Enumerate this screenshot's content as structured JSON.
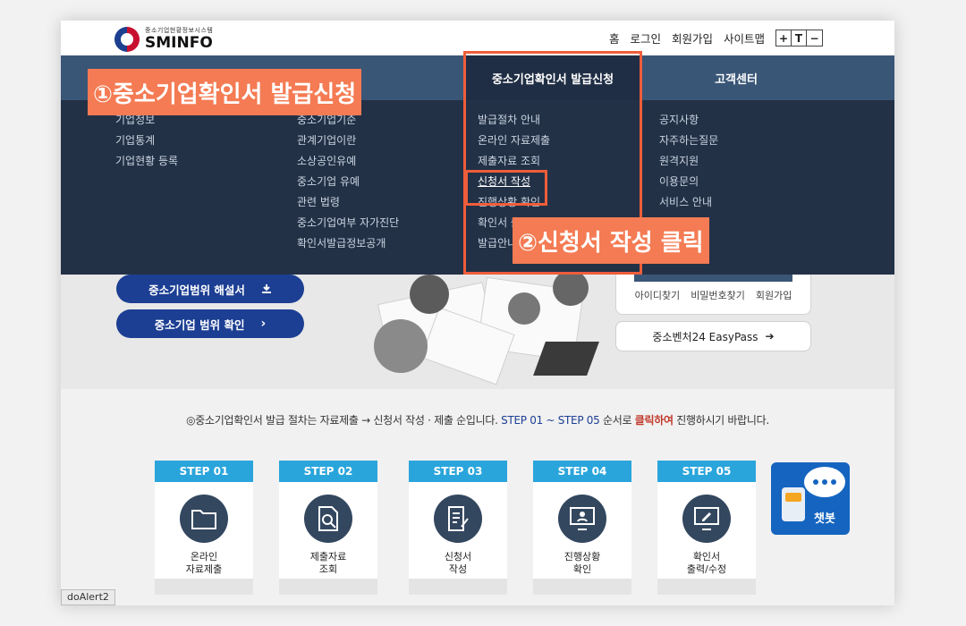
{
  "header": {
    "logo_sub": "중소기업현황정보시스템",
    "logo_main": "SMINFO",
    "util": [
      "홈",
      "로그인",
      "회원가입",
      "사이트맵"
    ],
    "font_controls": [
      "+",
      "T",
      "−"
    ]
  },
  "gnb": {
    "active": "중소기업확인서 발급신청",
    "customer": "고객센터"
  },
  "mega": {
    "col1": [
      "기업정보",
      "기업통계",
      "기업현황 등록"
    ],
    "col2": [
      "중소기업기준",
      "관계기업이란",
      "소상공인유예",
      "중소기업 유예",
      "관련 법령",
      "중소기업여부 자가진단",
      "확인서발급정보공개"
    ],
    "col3": [
      "발급절차 안내",
      "온라인 자료제출",
      "제출자료 조회",
      "신청서 작성",
      "진행상황 확인",
      "확인서 출력",
      "발급안내"
    ],
    "col4": [
      "공지사항",
      "자주하는질문",
      "원격지원",
      "이용문의",
      "서비스 안내"
    ]
  },
  "hero": {
    "btn_guide": "중소기업범위 해설서",
    "btn_check": "중소기업 범위 확인",
    "login_links": [
      "아이디찾기",
      "비밀번호찾기",
      "회원가입"
    ],
    "easypass": "중소벤처24 EasyPass"
  },
  "notice": {
    "prefix": "◎중소기업확인서 발급 절차는 자료제출 → 신청서 작성 · 제출 순입니다.",
    "steps_range": "STEP 01 ~ STEP 05",
    "mid": "순서로",
    "click": "클릭하여",
    "suffix": "진행하시기 바랍니다."
  },
  "steps": [
    {
      "head": "STEP 01",
      "label": "온라인\n자료제출"
    },
    {
      "head": "STEP 02",
      "label": "제출자료\n조회"
    },
    {
      "head": "STEP 03",
      "label": "신청서\n작성"
    },
    {
      "head": "STEP 04",
      "label": "진행상황\n확인"
    },
    {
      "head": "STEP 05",
      "label": "확인서\n출력/수정"
    }
  ],
  "chatbot": "챗봇",
  "status_tip": "doAlert2",
  "annotations": {
    "label1": "①중소기업확인서 발급신청",
    "label2": "②신청서 작성 클릭"
  },
  "colors": {
    "gnb": "#3a5677",
    "mega": "#233147",
    "accent": "#ef5d3a",
    "step_head": "#2aa5dc",
    "button": "#1c3f93"
  }
}
